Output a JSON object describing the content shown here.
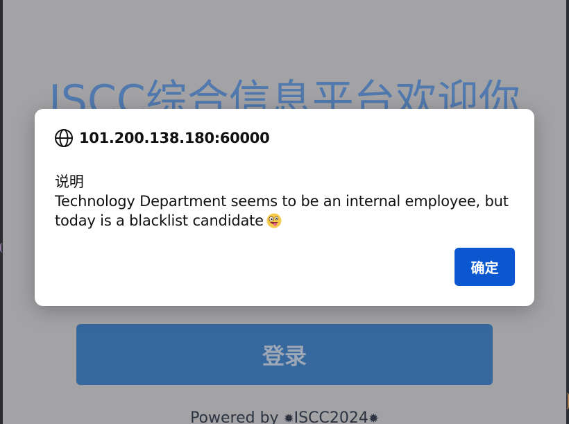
{
  "page": {
    "title": "ISCC综合信息平台欢迎你",
    "login_label": "登录",
    "powered_prefix": "Powered by ",
    "powered_brand": "ISCC2024"
  },
  "dialog": {
    "origin": "101.200.138.180:60000",
    "heading": "说明",
    "message": "Technology Department seems to be an internal employee, but today is a blacklist candidate",
    "ok_label": "确定",
    "icon": "globe-icon",
    "emoji": "zany-face-emoji"
  },
  "colors": {
    "overlay": "#a3a3a6",
    "title": "#5179ae",
    "login_button": "#36689e",
    "dialog_bg": "#ffffff",
    "ok_button": "#0b57d0"
  }
}
